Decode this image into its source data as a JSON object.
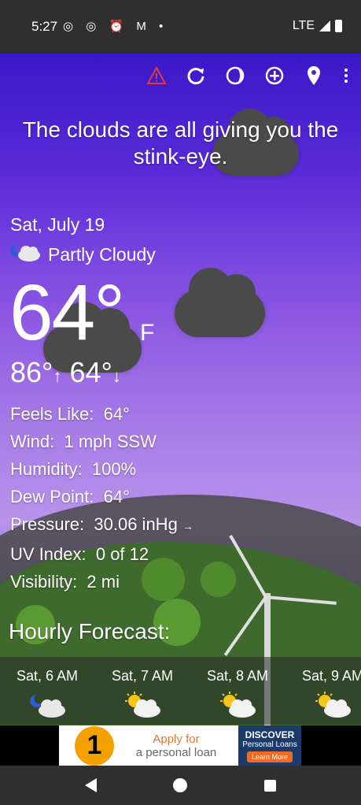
{
  "status_bar": {
    "time": "5:27",
    "network": "LTE",
    "notification_icons": [
      "instagram-icon",
      "instagram-icon",
      "alarm-icon",
      "gmail-icon",
      "dot-icon"
    ]
  },
  "toolbar": {
    "icons": [
      "alert-icon",
      "refresh-icon",
      "theme-icon",
      "add-location-icon",
      "location-pin-icon",
      "more-icon"
    ]
  },
  "quote": "The clouds are all giving you the stink-eye.",
  "current": {
    "date": "Sat, July 19",
    "condition": "Partly Cloudy",
    "temp": "64°",
    "unit": "F",
    "high": "86°",
    "low": "64°"
  },
  "details": [
    {
      "label": "Feels Like:",
      "value": "64°"
    },
    {
      "label": "Wind:",
      "value": "1 mph SSW"
    },
    {
      "label": "Humidity:",
      "value": "100%"
    },
    {
      "label": "Dew Point:",
      "value": "64°"
    },
    {
      "label": "Pressure:",
      "value": "30.06 inHg"
    },
    {
      "label": "UV Index:",
      "value": "0 of 12"
    },
    {
      "label": "Visibility:",
      "value": "2 mi"
    }
  ],
  "hourly": {
    "title": "Hourly Forecast:",
    "items": [
      {
        "time": "Sat, 6 AM",
        "icon": "night-partly-cloudy-icon"
      },
      {
        "time": "Sat, 7 AM",
        "icon": "day-partly-cloudy-icon"
      },
      {
        "time": "Sat, 8 AM",
        "icon": "day-partly-cloudy-icon"
      },
      {
        "time": "Sat, 9 AM",
        "icon": "day-partly-cloudy-icon"
      }
    ]
  },
  "ad": {
    "badge": "1",
    "line1": "Apply for",
    "line2": "a personal loan",
    "brand": "DISCOVER",
    "brand_sub": "Personal Loans",
    "cta": "Learn More"
  }
}
